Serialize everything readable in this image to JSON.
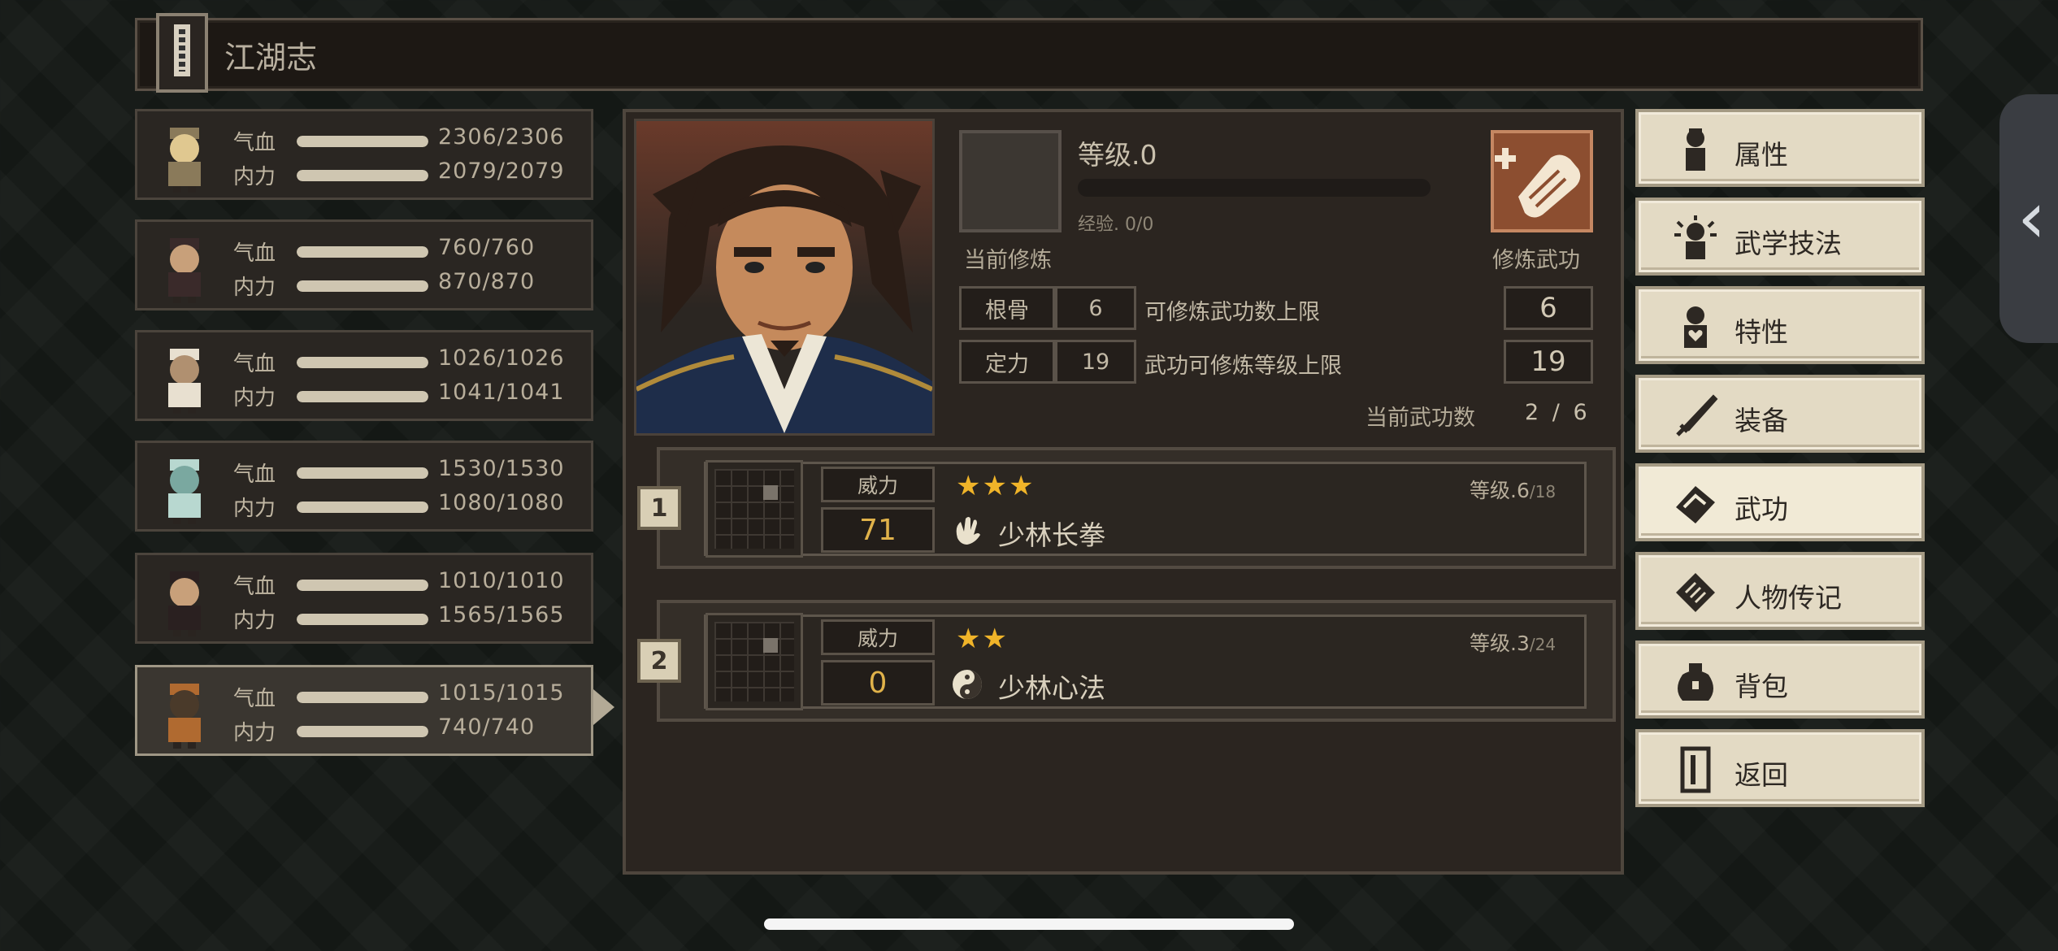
{
  "header": {
    "title": "江湖志"
  },
  "characters": [
    {
      "hp_label": "气血",
      "mp_label": "内力",
      "hp": "2306/2306",
      "mp": "2079/2079",
      "hp_frac": 1,
      "mp_frac": 1,
      "selected": false
    },
    {
      "hp_label": "气血",
      "mp_label": "内力",
      "hp": "760/760",
      "mp": "870/870",
      "hp_frac": 1,
      "mp_frac": 1,
      "selected": false
    },
    {
      "hp_label": "气血",
      "mp_label": "内力",
      "hp": "1026/1026",
      "mp": "1041/1041",
      "hp_frac": 1,
      "mp_frac": 1,
      "selected": false
    },
    {
      "hp_label": "气血",
      "mp_label": "内力",
      "hp": "1530/1530",
      "mp": "1080/1080",
      "hp_frac": 1,
      "mp_frac": 1,
      "selected": false
    },
    {
      "hp_label": "气血",
      "mp_label": "内力",
      "hp": "1010/1010",
      "mp": "1565/1565",
      "hp_frac": 1,
      "mp_frac": 1,
      "selected": false
    },
    {
      "hp_label": "气血",
      "mp_label": "内力",
      "hp": "1015/1015",
      "mp": "740/740",
      "hp_frac": 1,
      "mp_frac": 1,
      "selected": true
    }
  ],
  "cultivation": {
    "level": "等级.0",
    "exp": "经验. 0/0",
    "exp_frac": 0,
    "current_label": "当前修炼",
    "train_label": "修炼武功"
  },
  "stats": [
    {
      "name": "根骨",
      "value": "6",
      "desc": "可修炼武功数上限",
      "cap": "6"
    },
    {
      "name": "定力",
      "value": "19",
      "desc": "武功可修炼等级上限",
      "cap": "19"
    }
  ],
  "skill_count": {
    "label": "当前武功数",
    "value": "2 / 6"
  },
  "skills": [
    {
      "num": "1",
      "power_label": "威力",
      "power": "71",
      "stars": "★★★",
      "star_count": 3,
      "name": "少林长拳",
      "type_icon": "palm-icon",
      "level": "等级.6",
      "max": "/18"
    },
    {
      "num": "2",
      "power_label": "威力",
      "power": "0",
      "stars": "★★",
      "star_count": 2,
      "name": "少林心法",
      "type_icon": "yin-yang-icon",
      "level": "等级.3",
      "max": "/24"
    }
  ],
  "menu": [
    {
      "label": "属性",
      "icon": "figure-icon",
      "active": false
    },
    {
      "label": "武学技法",
      "icon": "aura-figure-icon",
      "active": false
    },
    {
      "label": "特性",
      "icon": "heart-figure-icon",
      "active": false
    },
    {
      "label": "装备",
      "icon": "sword-icon",
      "active": false
    },
    {
      "label": "武功",
      "icon": "scroll-book-icon",
      "active": true
    },
    {
      "label": "人物传记",
      "icon": "biography-book-icon",
      "active": false
    },
    {
      "label": "背包",
      "icon": "bag-icon",
      "active": false
    },
    {
      "label": "返回",
      "icon": "door-icon",
      "active": false
    }
  ],
  "colors": {
    "accent": "#e0b24a",
    "star": "#f0b429",
    "panel": "#2b2520",
    "menu_bg": "#e3dac4"
  }
}
